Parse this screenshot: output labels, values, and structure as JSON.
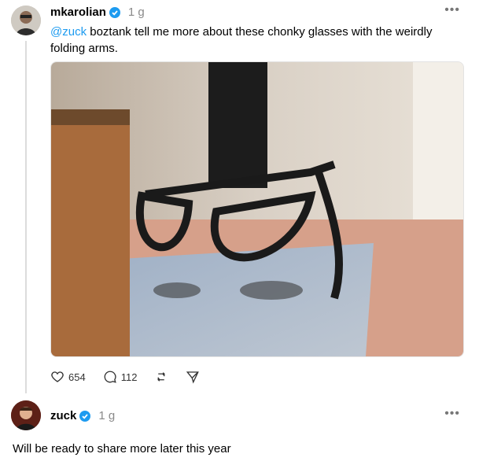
{
  "post1": {
    "username": "mkarolian",
    "time": "1 g",
    "mention": "@zuck",
    "text": " boztank tell me more about these chonky glasses with the weirdly folding arms.",
    "actions": {
      "likes": "654",
      "comments": "112"
    }
  },
  "post2": {
    "username": "zuck",
    "time": "1 g",
    "text": "Will be ready to share more later this year"
  },
  "colors": {
    "accent": "#1d9bf0",
    "muted": "#8a8a8a"
  }
}
